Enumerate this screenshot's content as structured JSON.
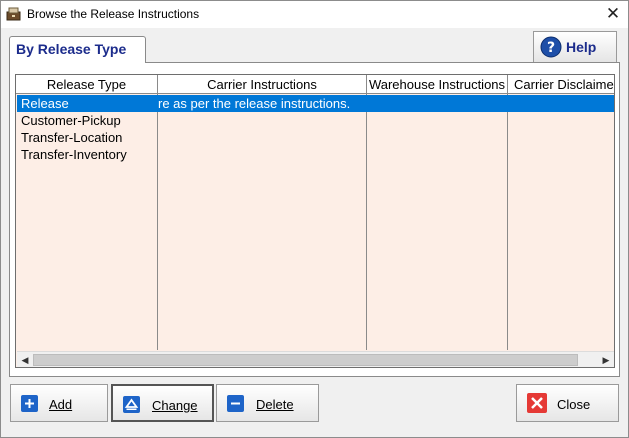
{
  "window": {
    "title": "Browse the Release Instructions",
    "close_glyph": "✕"
  },
  "tabs": [
    {
      "label": "By Release Type"
    }
  ],
  "help": {
    "label": "Help",
    "icon": "question-circle-icon"
  },
  "grid": {
    "columns": [
      "Release Type",
      "Carrier Instructions",
      "Warehouse Instructions",
      "Carrier Disclaimer"
    ],
    "rows": [
      {
        "release_type": "Release",
        "carrier_instructions": "re as per the release instructions.",
        "selected": true
      },
      {
        "release_type": "Customer-Pickup",
        "carrier_instructions": "",
        "selected": false
      },
      {
        "release_type": "Transfer-Location",
        "carrier_instructions": "",
        "selected": false
      },
      {
        "release_type": "Transfer-Inventory",
        "carrier_instructions": "",
        "selected": false
      }
    ]
  },
  "buttons": {
    "add": {
      "label": "Add",
      "icon": "plus-icon"
    },
    "change": {
      "label": "Change",
      "icon": "triangle-up-icon"
    },
    "delete": {
      "label": "Delete",
      "icon": "minus-icon"
    },
    "close": {
      "label": "Close",
      "icon": "x-icon"
    }
  },
  "colors": {
    "selection": "#0078d7",
    "grid_bg": "#fdeee6",
    "tab_text": "#1c2c8c",
    "close_red": "#e53935",
    "button_blue": "#1e64c8"
  }
}
